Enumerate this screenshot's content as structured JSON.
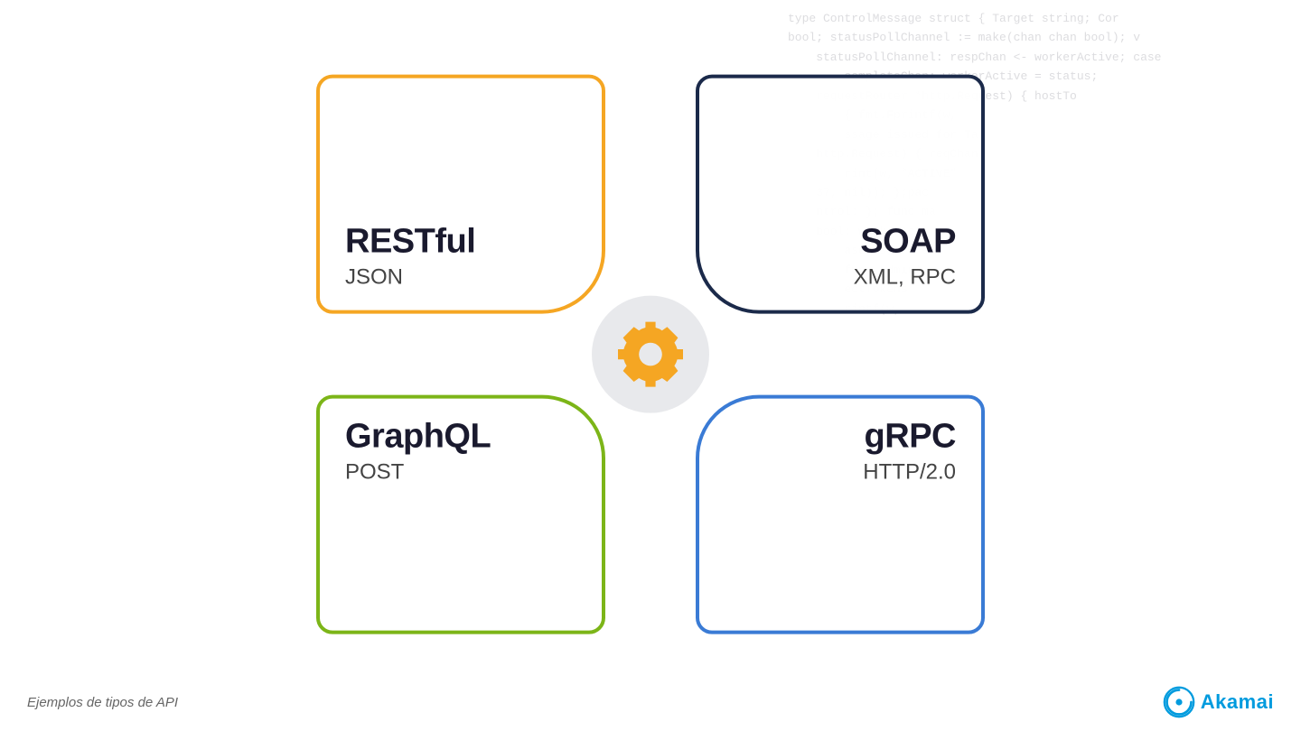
{
  "code_bg": {
    "lines": "type ControlMessage struct { Target string; Cor\nbool; statusPollChannel := make(chan chan bool); v\ntatusPollChannel: respChan <- workerActive; case\nompleteChan: workerActive = status;\nequestRouter *http.Request) { hostTo\n{ fmt.Fprintf(w,\nssage issued for Ta\nhttp.Request) { reqChan\nrint(w, \"ACTIVE\"\n37, nil)); }pac\nntrol: }; func ma\nbool: workerAct\nase.msg re e\nfunc admin(\nectTokens\nrintf(w,"
  },
  "diagram": {
    "center_icon": "gear",
    "quadrants": [
      {
        "id": "restful",
        "title": "RESTful",
        "subtitle": "JSON",
        "position": "top-left",
        "border_color": "#f5a623"
      },
      {
        "id": "soap",
        "title": "SOAP",
        "subtitle": "XML, RPC",
        "position": "top-right",
        "border_color": "#1b2a4a"
      },
      {
        "id": "graphql",
        "title": "GraphQL",
        "subtitle": "POST",
        "position": "bottom-left",
        "border_color": "#7cb518"
      },
      {
        "id": "grpc",
        "title": "gRPC",
        "subtitle": "HTTP/2.0",
        "position": "bottom-right",
        "border_color": "#3a7bd5"
      }
    ]
  },
  "footer": {
    "label": "Ejemplos de tipos de API"
  },
  "logo": {
    "name": "Akamai"
  }
}
